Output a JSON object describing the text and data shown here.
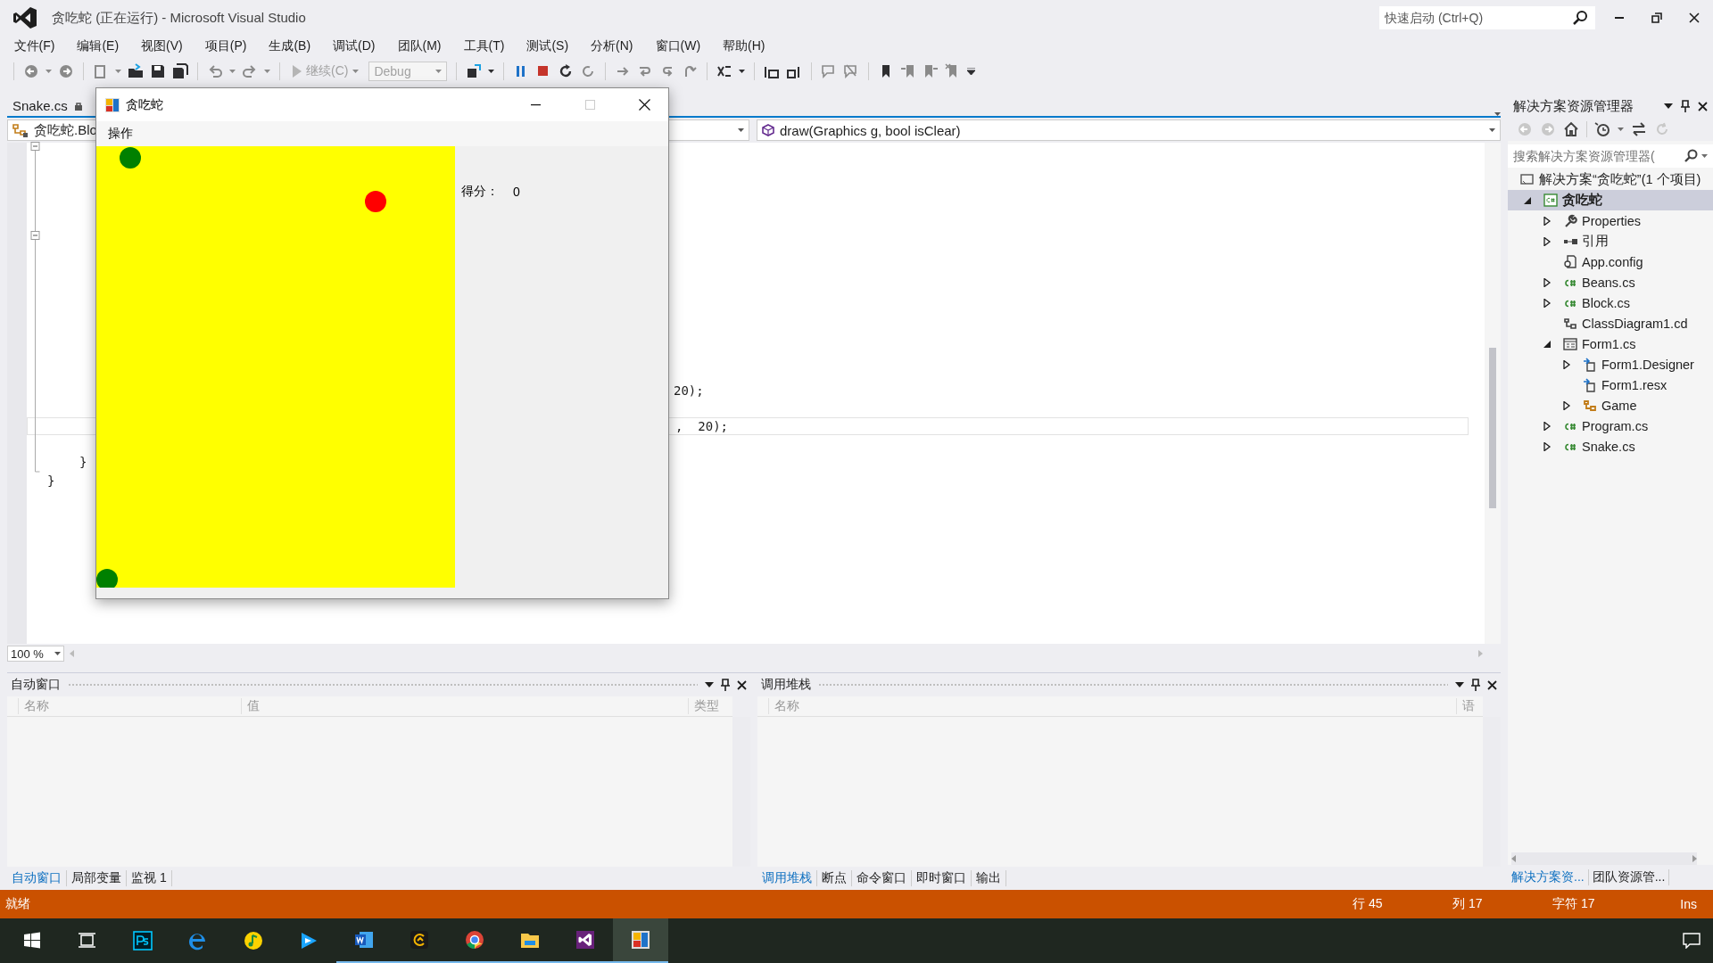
{
  "window": {
    "title": "贪吃蛇 (正在运行) - Microsoft Visual Studio",
    "quick_launch": {
      "placeholder": "快速启动 (Ctrl+Q)"
    }
  },
  "menu": [
    "文件(F)",
    "编辑(E)",
    "视图(V)",
    "项目(P)",
    "生成(B)",
    "调试(D)",
    "团队(M)",
    "工具(T)",
    "测试(S)",
    "分析(N)",
    "窗口(W)",
    "帮助(H)"
  ],
  "toolbar": {
    "continue": {
      "label": "继续(C)",
      "disabled": true
    },
    "configuration": {
      "value": "Debug",
      "disabled": true
    }
  },
  "editor": {
    "tabs": [
      {
        "label": "Snake.cs",
        "selected": true
      }
    ],
    "nav_left": "贪吃蛇.Blo",
    "nav_right": "draw(Graphics g, bool isClear)",
    "lines": [
      {
        "text": "20);",
        "current": false
      },
      {
        "text": ",  20);",
        "current": true
      },
      {
        "text": "}",
        "current": false
      },
      {
        "text": "}",
        "current": false
      }
    ],
    "zoom": "100 %"
  },
  "panels": [
    {
      "title": "自动窗口",
      "columns": [
        "名称",
        "值",
        "类型"
      ],
      "tabs": [
        {
          "label": "自动窗口",
          "selected": true
        },
        {
          "label": "局部变量",
          "selected": false
        },
        {
          "label": "监视 1",
          "selected": false
        }
      ]
    },
    {
      "title": "调用堆栈",
      "columns": [
        "名称",
        "语"
      ],
      "tabs": [
        {
          "label": "调用堆栈",
          "selected": true
        },
        {
          "label": "断点",
          "selected": false
        },
        {
          "label": "命令窗口",
          "selected": false
        },
        {
          "label": "即时窗口",
          "selected": false
        },
        {
          "label": "输出",
          "selected": false
        }
      ]
    }
  ],
  "solution_explorer": {
    "title": "解决方案资源管理器",
    "search": {
      "placeholder": "搜索解决方案资源管理器("
    },
    "tree": [
      {
        "label": "解决方案“贪吃蛇”(1 个项目)",
        "kind": "solution",
        "selected": false,
        "children": [
          {
            "label": "贪吃蛇",
            "kind": "project",
            "expanded": true,
            "selected": true,
            "children": [
              {
                "label": "Properties",
                "kind": "properties",
                "expanded": false,
                "selected": false
              },
              {
                "label": "引用",
                "kind": "references",
                "expanded": false,
                "selected": false
              },
              {
                "label": "App.config",
                "kind": "config",
                "selected": false
              },
              {
                "label": "Beans.cs",
                "kind": "csharp",
                "expanded": false,
                "selected": false
              },
              {
                "label": "Block.cs",
                "kind": "csharp",
                "expanded": false,
                "selected": false
              },
              {
                "label": "ClassDiagram1.cd",
                "kind": "diagram",
                "selected": false
              },
              {
                "label": "Form1.cs",
                "kind": "form",
                "expanded": true,
                "selected": false,
                "children": [
                  {
                    "label": "Form1.Designer",
                    "kind": "designer",
                    "expanded": false,
                    "selected": false
                  },
                  {
                    "label": "Form1.resx",
                    "kind": "designer",
                    "selected": false
                  },
                  {
                    "label": "Game",
                    "kind": "class",
                    "expanded": false,
                    "selected": false
                  }
                ]
              },
              {
                "label": "Program.cs",
                "kind": "csharp",
                "expanded": false,
                "selected": false
              },
              {
                "label": "Snake.cs",
                "kind": "csharp",
                "expanded": false,
                "selected": false
              }
            ]
          }
        ]
      }
    ],
    "tabs": [
      {
        "label": "解决方案资...",
        "selected": true
      },
      {
        "label": "团队资源管...",
        "selected": false
      }
    ]
  },
  "status_bar": {
    "text": "就绪",
    "line": "行 45",
    "column": "列 17",
    "char": "字符 17",
    "mode": "Ins"
  },
  "taskbar": [
    {
      "kind": "start",
      "running": false,
      "selected": false
    },
    {
      "kind": "taskview",
      "running": false,
      "selected": false
    },
    {
      "kind": "photoshop",
      "running": false,
      "selected": false
    },
    {
      "kind": "edge",
      "running": false,
      "selected": false
    },
    {
      "kind": "music",
      "running": false,
      "selected": false
    },
    {
      "kind": "video",
      "running": false,
      "selected": false
    },
    {
      "kind": "word",
      "running": true,
      "selected": false
    },
    {
      "kind": "gapp",
      "running": true,
      "selected": false
    },
    {
      "kind": "chrome",
      "running": true,
      "selected": false
    },
    {
      "kind": "files",
      "running": true,
      "selected": false
    },
    {
      "kind": "vs",
      "running": true,
      "selected": false
    },
    {
      "kind": "game",
      "running": true,
      "selected": true
    }
  ],
  "game_window": {
    "title": "贪吃蛇",
    "menu": [
      "操作"
    ],
    "score_label": "得分：",
    "score": "0",
    "dots": [
      {
        "color": "#008000"
      },
      {
        "color": "#ff0000"
      },
      {
        "color": "#008000"
      }
    ]
  }
}
